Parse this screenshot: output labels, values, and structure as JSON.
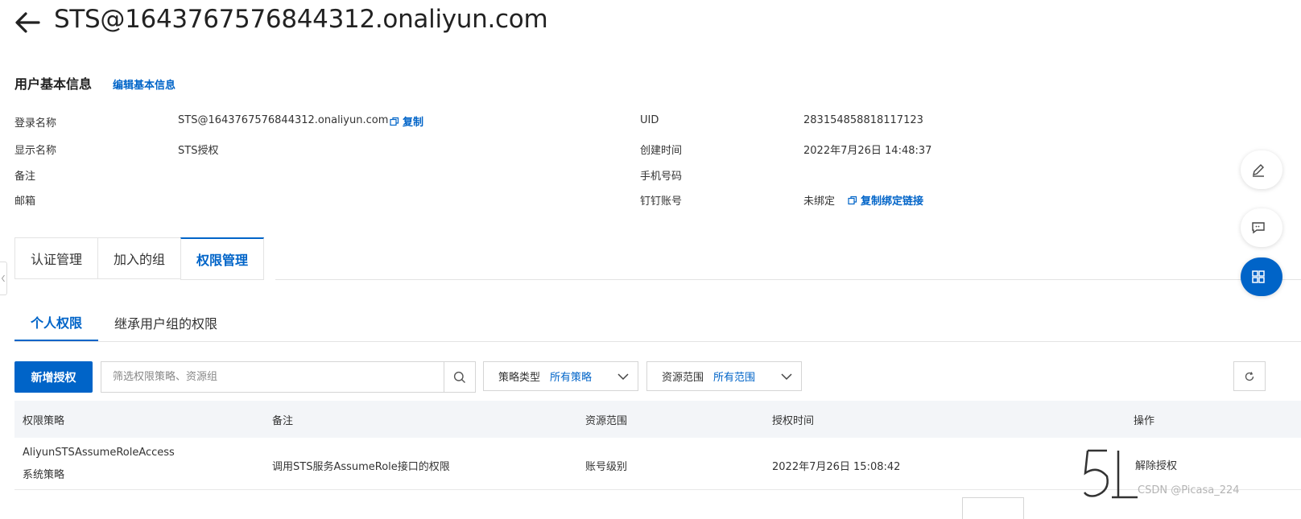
{
  "header": {
    "title": "STS@1643767576844312.onaliyun.com"
  },
  "basic_info": {
    "section_title": "用户基本信息",
    "edit_link": "编辑基本信息",
    "left": [
      {
        "label": "登录名称",
        "value": "STS@1643767576844312.onaliyun.com",
        "action": "复制"
      },
      {
        "label": "显示名称",
        "value": "STS授权"
      },
      {
        "label": "备注",
        "value": ""
      },
      {
        "label": "邮箱",
        "value": ""
      }
    ],
    "right": [
      {
        "label": "UID",
        "value": "283154858818117123"
      },
      {
        "label": "创建时间",
        "value": "2022年7月26日 14:48:37"
      },
      {
        "label": "手机号码",
        "value": ""
      },
      {
        "label": "钉钉账号",
        "value": "未绑定",
        "action": "复制绑定链接"
      }
    ]
  },
  "tabs": [
    {
      "label": "认证管理",
      "active": false
    },
    {
      "label": "加入的组",
      "active": false
    },
    {
      "label": "权限管理",
      "active": true
    }
  ],
  "subtabs": [
    {
      "label": "个人权限",
      "active": true
    },
    {
      "label": "继承用户组的权限",
      "active": false
    }
  ],
  "toolbar": {
    "add_button": "新增授权",
    "search_placeholder": "筛选权限策略、资源组",
    "policy_type": {
      "label": "策略类型",
      "value": "所有策略"
    },
    "resource_scope": {
      "label": "资源范围",
      "value": "所有范围"
    }
  },
  "table": {
    "columns": [
      "权限策略",
      "备注",
      "资源范围",
      "授权时间",
      "操作"
    ],
    "rows": [
      {
        "policy_name": "AliyunSTSAssumeRoleAccess",
        "policy_type": "系统策略",
        "note": "调用STS服务AssumeRole接口的权限",
        "scope": "账号级别",
        "time": "2022年7月26日 15:08:42",
        "action": "解除授权"
      }
    ]
  },
  "watermark": {
    "text": "CSDN @Picasa_224"
  },
  "colors": {
    "accent": "#0064c8",
    "text": "#333333",
    "border": "#d5d5d5",
    "header_bg": "#f3f5f8"
  }
}
